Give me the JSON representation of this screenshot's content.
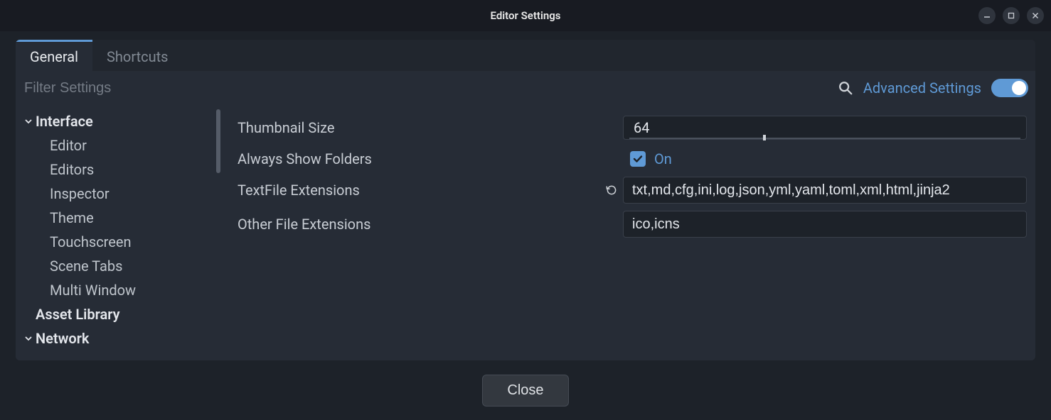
{
  "window": {
    "title": "Editor Settings"
  },
  "tabs": {
    "general": "General",
    "shortcuts": "Shortcuts"
  },
  "filter": {
    "placeholder": "Filter Settings"
  },
  "advanced": {
    "label": "Advanced Settings",
    "on": true
  },
  "sidebar": {
    "groups": [
      {
        "label": "Interface",
        "expanded": true,
        "children": [
          "Editor",
          "Editors",
          "Inspector",
          "Theme",
          "Touchscreen",
          "Scene Tabs",
          "Multi Window"
        ]
      },
      {
        "label": "Asset Library",
        "expanded": false,
        "children": []
      },
      {
        "label": "Network",
        "expanded": true,
        "children": []
      }
    ]
  },
  "settings": {
    "thumbnail_size": {
      "label": "Thumbnail Size",
      "value": "64",
      "min": 0,
      "max": 192,
      "handle_frac": 0.333,
      "reset": false
    },
    "always_show_folders": {
      "label": "Always Show Folders",
      "checked": true,
      "on_label": "On",
      "reset": false
    },
    "textfile_extensions": {
      "label": "TextFile Extensions",
      "value": "txt,md,cfg,ini,log,json,yml,yaml,toml,xml,html,jinja2",
      "reset": true
    },
    "other_file_extensions": {
      "label": "Other File Extensions",
      "value": "ico,icns",
      "reset": false
    }
  },
  "footer": {
    "close": "Close"
  }
}
